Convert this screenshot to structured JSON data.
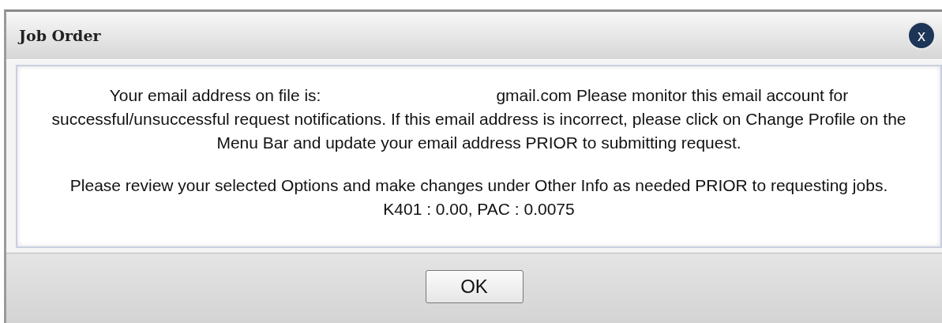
{
  "dialog": {
    "title": "Job Order",
    "close_label": "x"
  },
  "messages": [
    {
      "kind": "email",
      "lead": "Your email address on file is:",
      "text": "gmail.com Please monitor this email account for successful/unsuccessful request notifications. If this email address is incorrect, please click on Change Profile on the Menu Bar and update your email address PRIOR to submitting request."
    },
    {
      "kind": "plain",
      "text": "Please review your selected Options and make changes under Other Info as needed PRIOR to requesting jobs. K401 : 0.00, PAC : 0.0075"
    }
  ],
  "buttons": [
    "OK"
  ]
}
